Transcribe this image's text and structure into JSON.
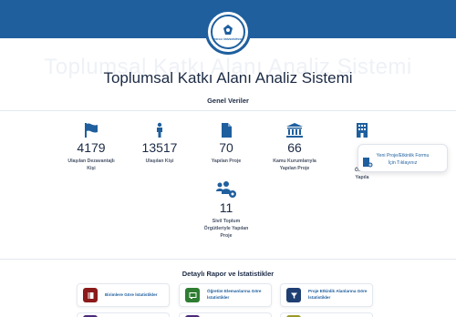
{
  "colors": {
    "primary": "#1f5f9e",
    "text": "#1b2a44",
    "muted": "#4a5568",
    "card_red": "#8b1a1a",
    "card_green": "#2e7d32",
    "card_navy": "#1f3f73",
    "card_purple": "#4a2a7a",
    "card_olive": "#9a9a2a"
  },
  "logo": {
    "text": "DICLE ÜNİVERSİTESİ"
  },
  "page": {
    "ghost_title": "Toplumsal Katkı Alanı Analiz Sistemi",
    "title": "Toplumsal Katkı Alanı Analiz Sistemi"
  },
  "general": {
    "heading": "Genel Veriler",
    "stats": [
      {
        "icon": "flag-icon",
        "value": "4179",
        "label_line1": "Ulaşılan Dezavantajlı",
        "label_line2": "Kişi"
      },
      {
        "icon": "person-icon",
        "value": "13517",
        "label_line1": "Ulaşılan Kişi",
        "label_line2": ""
      },
      {
        "icon": "file-icon",
        "value": "70",
        "label_line1": "Yapılan Proje",
        "label_line2": ""
      },
      {
        "icon": "institution-icon",
        "value": "66",
        "label_line1": "Kamu Kurumlarıyla",
        "label_line2": "Yapılan Proje"
      },
      {
        "icon": "building-icon",
        "value": "",
        "label_line1": "Özel K",
        "label_line2": "Yapıla"
      },
      {
        "icon": "users-cog-icon",
        "value": "11",
        "label_line1": "Sivil Toplum",
        "label_line2": "Örgütleriyle Yapılan",
        "label_line3": "Proje"
      }
    ]
  },
  "toast": {
    "line1": "Yeni Proje/Etkinlik Formu",
    "line2": "İçin Tıklayınız"
  },
  "reports": {
    "heading": "Detaylı Rapor ve İstatistikler",
    "cards": [
      {
        "icon": "book-icon",
        "label_line1": "Birimlere Göre İstatistikler",
        "label_line2": ""
      },
      {
        "icon": "chalkboard-icon",
        "label_line1": "Öğretim Elemanlarına Göre",
        "label_line2": "İstatistikler"
      },
      {
        "icon": "filter-icon",
        "label_line1": "Proje Etkinlik Alanlarına Göre",
        "label_line2": "İstatistikler"
      }
    ]
  }
}
